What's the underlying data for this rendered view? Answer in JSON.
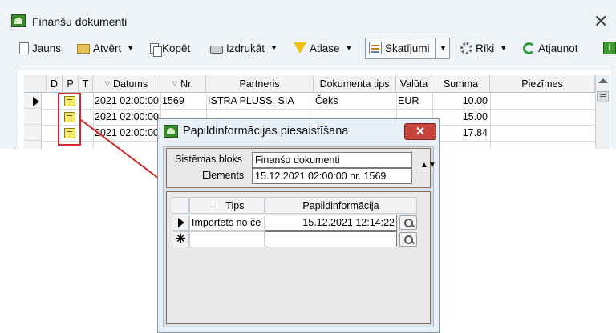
{
  "window": {
    "title": "Finanšu dokumenti"
  },
  "toolbar": {
    "jauns": "Jauns",
    "atvert": "Atvērt",
    "kopet": "Kopēt",
    "izdrukat": "Izdrukāt",
    "atlase": "Atlase",
    "skatijumi": "Skatījumi",
    "riki": "Rīki",
    "atjaunot": "Atjaunot",
    "caret": "▼"
  },
  "grid": {
    "headers": {
      "d": "D",
      "p": "P",
      "t": "T",
      "datums": "Datums",
      "nr": "Nr.",
      "partneris": "Partneris",
      "dokumenta_tips": "Dokumenta tips",
      "valuta": "Valūta",
      "summa": "Summa",
      "piezimes": "Piezīmes"
    },
    "rows": [
      {
        "datums": "2021 02:00:00",
        "nr": "1569",
        "partneris": "ISTRA PLUSS, SIA",
        "tips": "Čeks",
        "valuta": "EUR",
        "summa": "10.00"
      },
      {
        "datums": "2021 02:00:00",
        "nr": "",
        "partneris": "",
        "tips": "",
        "valuta": "",
        "summa": "15.00"
      },
      {
        "datums": "2021 02:00:00",
        "nr": "",
        "partneris": "",
        "tips": "",
        "valuta": "",
        "summa": "17.84"
      }
    ]
  },
  "dialog": {
    "title": "Papildinformācijas piesaistīšana",
    "close": "✕",
    "system_block_label": "Sistēmas bloks",
    "system_block_value": "Finanšu dokumenti",
    "elements_label": "Elements",
    "elements_value": "15.12.2021 02:00:00 nr. 1569",
    "spin": "▲▼",
    "grid": {
      "col_tips": "Tips",
      "col_info": "Papildinformācija",
      "rows": [
        {
          "tips": "Importēts no če",
          "info": "15.12.2021 12:14:22"
        }
      ],
      "new_row_marker": "✳"
    }
  }
}
